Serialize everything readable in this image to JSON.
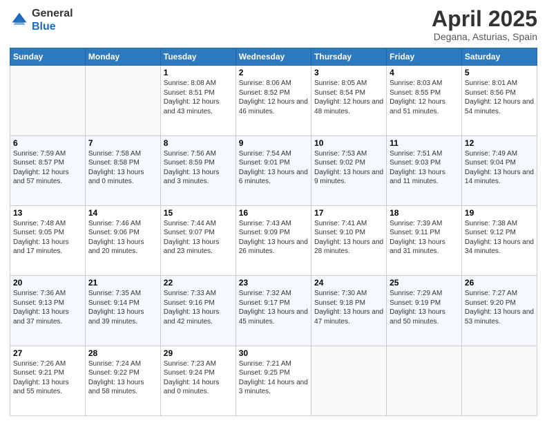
{
  "header": {
    "logo_general": "General",
    "logo_blue": "Blue",
    "month_title": "April 2025",
    "location": "Degana, Asturias, Spain"
  },
  "weekdays": [
    "Sunday",
    "Monday",
    "Tuesday",
    "Wednesday",
    "Thursday",
    "Friday",
    "Saturday"
  ],
  "weeks": [
    [
      {
        "day": "",
        "info": ""
      },
      {
        "day": "",
        "info": ""
      },
      {
        "day": "1",
        "info": "Sunrise: 8:08 AM\nSunset: 8:51 PM\nDaylight: 12 hours and 43 minutes."
      },
      {
        "day": "2",
        "info": "Sunrise: 8:06 AM\nSunset: 8:52 PM\nDaylight: 12 hours and 46 minutes."
      },
      {
        "day": "3",
        "info": "Sunrise: 8:05 AM\nSunset: 8:54 PM\nDaylight: 12 hours and 48 minutes."
      },
      {
        "day": "4",
        "info": "Sunrise: 8:03 AM\nSunset: 8:55 PM\nDaylight: 12 hours and 51 minutes."
      },
      {
        "day": "5",
        "info": "Sunrise: 8:01 AM\nSunset: 8:56 PM\nDaylight: 12 hours and 54 minutes."
      }
    ],
    [
      {
        "day": "6",
        "info": "Sunrise: 7:59 AM\nSunset: 8:57 PM\nDaylight: 12 hours and 57 minutes."
      },
      {
        "day": "7",
        "info": "Sunrise: 7:58 AM\nSunset: 8:58 PM\nDaylight: 13 hours and 0 minutes."
      },
      {
        "day": "8",
        "info": "Sunrise: 7:56 AM\nSunset: 8:59 PM\nDaylight: 13 hours and 3 minutes."
      },
      {
        "day": "9",
        "info": "Sunrise: 7:54 AM\nSunset: 9:01 PM\nDaylight: 13 hours and 6 minutes."
      },
      {
        "day": "10",
        "info": "Sunrise: 7:53 AM\nSunset: 9:02 PM\nDaylight: 13 hours and 9 minutes."
      },
      {
        "day": "11",
        "info": "Sunrise: 7:51 AM\nSunset: 9:03 PM\nDaylight: 13 hours and 11 minutes."
      },
      {
        "day": "12",
        "info": "Sunrise: 7:49 AM\nSunset: 9:04 PM\nDaylight: 13 hours and 14 minutes."
      }
    ],
    [
      {
        "day": "13",
        "info": "Sunrise: 7:48 AM\nSunset: 9:05 PM\nDaylight: 13 hours and 17 minutes."
      },
      {
        "day": "14",
        "info": "Sunrise: 7:46 AM\nSunset: 9:06 PM\nDaylight: 13 hours and 20 minutes."
      },
      {
        "day": "15",
        "info": "Sunrise: 7:44 AM\nSunset: 9:07 PM\nDaylight: 13 hours and 23 minutes."
      },
      {
        "day": "16",
        "info": "Sunrise: 7:43 AM\nSunset: 9:09 PM\nDaylight: 13 hours and 26 minutes."
      },
      {
        "day": "17",
        "info": "Sunrise: 7:41 AM\nSunset: 9:10 PM\nDaylight: 13 hours and 28 minutes."
      },
      {
        "day": "18",
        "info": "Sunrise: 7:39 AM\nSunset: 9:11 PM\nDaylight: 13 hours and 31 minutes."
      },
      {
        "day": "19",
        "info": "Sunrise: 7:38 AM\nSunset: 9:12 PM\nDaylight: 13 hours and 34 minutes."
      }
    ],
    [
      {
        "day": "20",
        "info": "Sunrise: 7:36 AM\nSunset: 9:13 PM\nDaylight: 13 hours and 37 minutes."
      },
      {
        "day": "21",
        "info": "Sunrise: 7:35 AM\nSunset: 9:14 PM\nDaylight: 13 hours and 39 minutes."
      },
      {
        "day": "22",
        "info": "Sunrise: 7:33 AM\nSunset: 9:16 PM\nDaylight: 13 hours and 42 minutes."
      },
      {
        "day": "23",
        "info": "Sunrise: 7:32 AM\nSunset: 9:17 PM\nDaylight: 13 hours and 45 minutes."
      },
      {
        "day": "24",
        "info": "Sunrise: 7:30 AM\nSunset: 9:18 PM\nDaylight: 13 hours and 47 minutes."
      },
      {
        "day": "25",
        "info": "Sunrise: 7:29 AM\nSunset: 9:19 PM\nDaylight: 13 hours and 50 minutes."
      },
      {
        "day": "26",
        "info": "Sunrise: 7:27 AM\nSunset: 9:20 PM\nDaylight: 13 hours and 53 minutes."
      }
    ],
    [
      {
        "day": "27",
        "info": "Sunrise: 7:26 AM\nSunset: 9:21 PM\nDaylight: 13 hours and 55 minutes."
      },
      {
        "day": "28",
        "info": "Sunrise: 7:24 AM\nSunset: 9:22 PM\nDaylight: 13 hours and 58 minutes."
      },
      {
        "day": "29",
        "info": "Sunrise: 7:23 AM\nSunset: 9:24 PM\nDaylight: 14 hours and 0 minutes."
      },
      {
        "day": "30",
        "info": "Sunrise: 7:21 AM\nSunset: 9:25 PM\nDaylight: 14 hours and 3 minutes."
      },
      {
        "day": "",
        "info": ""
      },
      {
        "day": "",
        "info": ""
      },
      {
        "day": "",
        "info": ""
      }
    ]
  ]
}
